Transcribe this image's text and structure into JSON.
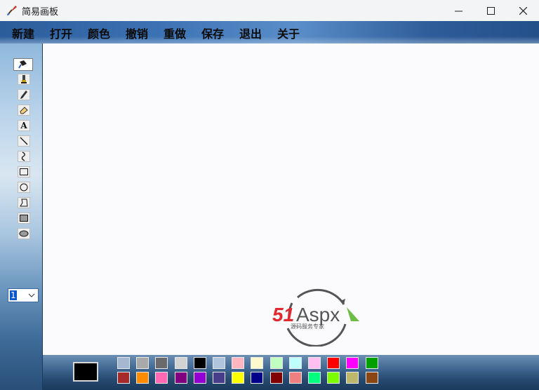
{
  "window": {
    "title": "简易画板",
    "controls": [
      "minimize",
      "maximize",
      "close"
    ]
  },
  "menu": {
    "items": [
      "新建",
      "打开",
      "颜色",
      "撤销",
      "重做",
      "保存",
      "退出",
      "关于"
    ]
  },
  "toolbox": {
    "tools": [
      {
        "name": "fill-bucket-icon",
        "selected": true
      },
      {
        "name": "marker-icon",
        "selected": false
      },
      {
        "name": "pencil-icon",
        "selected": false
      },
      {
        "name": "eraser-icon",
        "selected": false
      },
      {
        "name": "text-tool-icon",
        "selected": false
      },
      {
        "name": "line-icon",
        "selected": false
      },
      {
        "name": "curve-icon",
        "selected": false
      },
      {
        "name": "rectangle-icon",
        "selected": false
      },
      {
        "name": "ellipse-icon",
        "selected": false
      },
      {
        "name": "polygon-icon",
        "selected": false
      },
      {
        "name": "filled-rectangle-icon",
        "selected": false
      },
      {
        "name": "filled-ellipse-icon",
        "selected": false
      }
    ],
    "text_tool_glyph": "A",
    "line_width": "1"
  },
  "logo": {
    "brand_num": "51",
    "brand_text": "Aspx",
    "tagline": "源码服务专家"
  },
  "palette": {
    "current_color": "#000000",
    "row1": [
      "#a4b8cf",
      "#a9a9a9",
      "#6b6b6b",
      "#d3d3d3",
      "#000000",
      "#b0c4de",
      "#ffb6c1",
      "#fffacd",
      "#c1ffc1",
      "#bfffff",
      "#ffc0f0",
      "#ff0000",
      "#ff00ff",
      "#00a000"
    ],
    "row2": [
      "#a52a2a",
      "#ff8c00",
      "#ff69b4",
      "#800080",
      "#9400d3",
      "#483d8b",
      "#ffff00",
      "#00008b",
      "#800000",
      "#f08080",
      "#00ff7f",
      "#7cfc00",
      "#bdb76b",
      "#8b4513"
    ]
  },
  "colors": {
    "accent": "#0a58c8",
    "logo_red": "#e0282e",
    "logo_gray": "#555555",
    "logo_green": "#5cb531"
  }
}
